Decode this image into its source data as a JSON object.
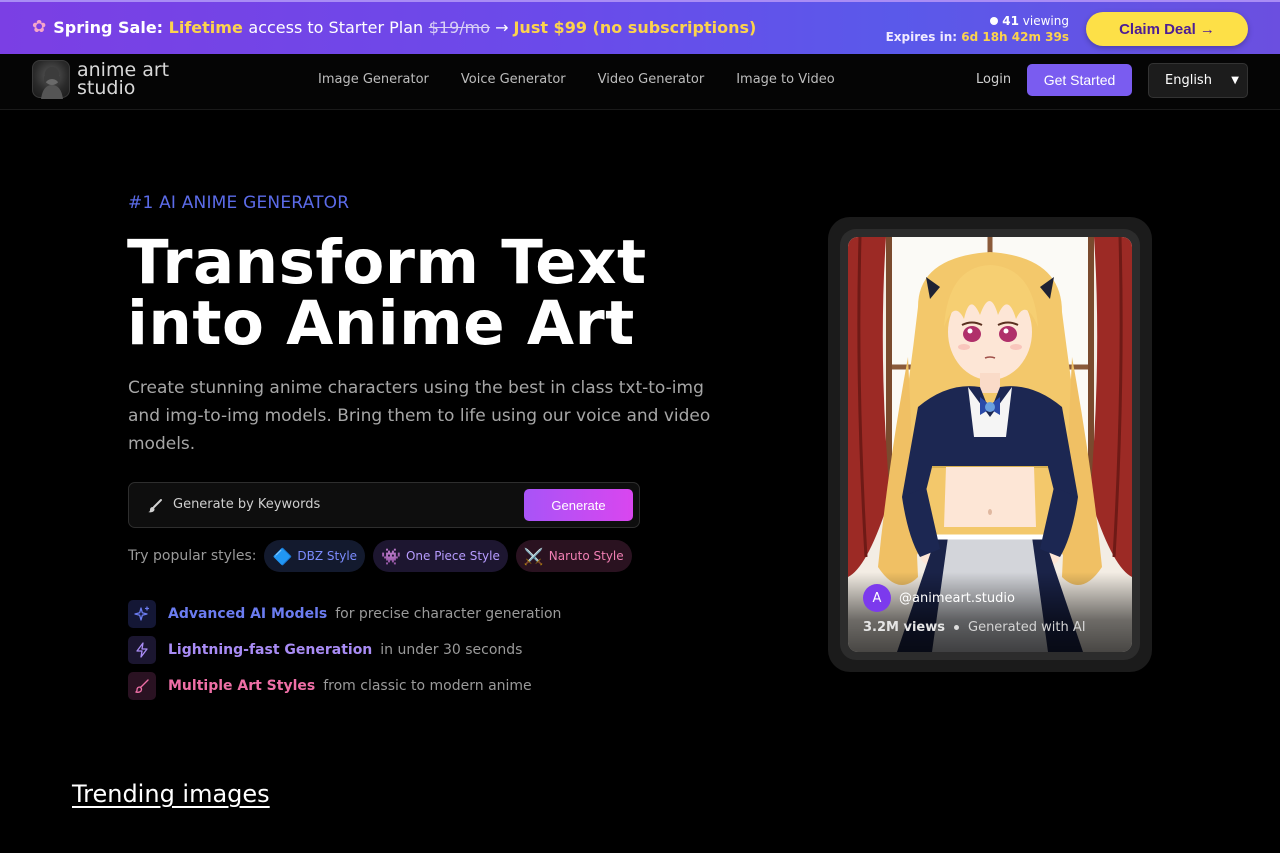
{
  "promo": {
    "flower_icon": "cherry-blossom-icon",
    "label": "Spring Sale:",
    "highlight": "Lifetime",
    "text": "access to Starter Plan",
    "old_price": "$19/mo",
    "arrow": "→",
    "new_price": "Just $99 (no subscriptions)",
    "viewing_count": "41",
    "viewing_label": "viewing",
    "expires_label": "Expires in:",
    "expires_time": "6d 18h 42m 39s",
    "cta": "Claim Deal →"
  },
  "nav": {
    "logo_line1": "anime art",
    "logo_line2": "studio",
    "links": [
      "Image Generator",
      "Voice Generator",
      "Video Generator",
      "Image to Video"
    ],
    "login": "Login",
    "get_started": "Get Started",
    "language": "English"
  },
  "hero": {
    "eyebrow": "#1 AI ANIME GENERATOR",
    "title_line1": "Transform Text",
    "title_line2": "into Anime Art",
    "description": "Create stunning anime characters using the best in class txt-to-img and img-to-img models. Bring them to life using our voice and video models.",
    "input_placeholder": "Generate by Keywords",
    "generate_button": "Generate",
    "styles_label": "Try popular styles:",
    "styles": [
      {
        "emoji": "🔷",
        "label": "DBZ Style"
      },
      {
        "emoji": "👾",
        "label": "One Piece Style"
      },
      {
        "emoji": "⚔️",
        "label": "Naruto Style"
      }
    ],
    "features": [
      {
        "icon": "sparkles-icon",
        "title": "Advanced AI Models",
        "desc": "for precise character generation"
      },
      {
        "icon": "lightning-icon",
        "title": "Lightning-fast Generation",
        "desc": "in under 30 seconds"
      },
      {
        "icon": "brush-icon",
        "title": "Multiple Art Styles",
        "desc": "from classic to modern anime"
      }
    ]
  },
  "showcase": {
    "avatar_letter": "A",
    "handle": "@animeart.studio",
    "views": "3.2M views",
    "generated": "Generated with AI"
  },
  "sections": {
    "trending": "Trending images"
  },
  "colors": {
    "accent": "#7a5cf0",
    "banner_highlight": "#fcd34d",
    "eyebrow": "#5b6be8"
  }
}
